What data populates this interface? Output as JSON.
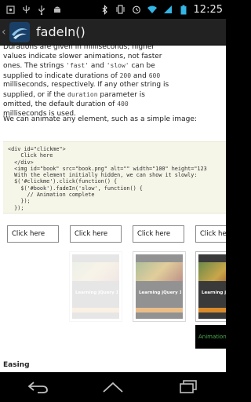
{
  "status_bar": {
    "time": "12:25",
    "left_icons": [
      "screenshot-icon",
      "trident-icon",
      "usb-icon",
      "android-icon"
    ],
    "right_icons": [
      "bluetooth-icon",
      "vibrate-icon",
      "alarm-icon",
      "wifi-icon",
      "signal-icon",
      "battery-icon"
    ]
  },
  "action_bar": {
    "title": "fadeIn()",
    "app_icon": "app-logo-icon"
  },
  "content": {
    "para1_line1": "Durations are given in milliseconds; higher",
    "para1_line2": "values indicate slower animations, not faster",
    "para1_line3_pre": "ones. The strings ",
    "fast": "'fast'",
    "and": " and ",
    "slow": "'slow'",
    "para1_line3_post": " can be",
    "para1_line4_pre": "supplied to indicate durations of ",
    "ms200": "200",
    "and2": " and ",
    "ms600": "600",
    "para1_line5": "milliseconds, respectively. If any other string is",
    "para1_line6_pre": "supplied, or if the ",
    "duration": "duration",
    "para1_line6_post": " parameter is",
    "para1_line7_pre": "omitted, the default duration of ",
    "ms400": "400",
    "para1_line8": "milliseconds is used.",
    "para2": "We can animate any element, such as a simple image:",
    "code": "<div id=\"clickme\">\n    Click here\n  </div>\n  <img id=\"book\" src=\"book.png\" alt=\"\" width=\"100\" height=\"123\n  With the element initially hidden, we can show it slowly:\n  $('#clickme').click(function() {\n    $('#book').fadeIn('slow', function() {\n      // Animation complete\n    });\n  });",
    "click_buttons": [
      "Click here",
      "Click here",
      "Click here",
      "Click here"
    ],
    "book_title": "Learning jQuery 1.3",
    "anim_complete": "Animation complete",
    "section_heading": "Easing"
  },
  "nav_bar": {
    "buttons": [
      "back-icon",
      "home-icon",
      "recent-apps-icon"
    ]
  }
}
